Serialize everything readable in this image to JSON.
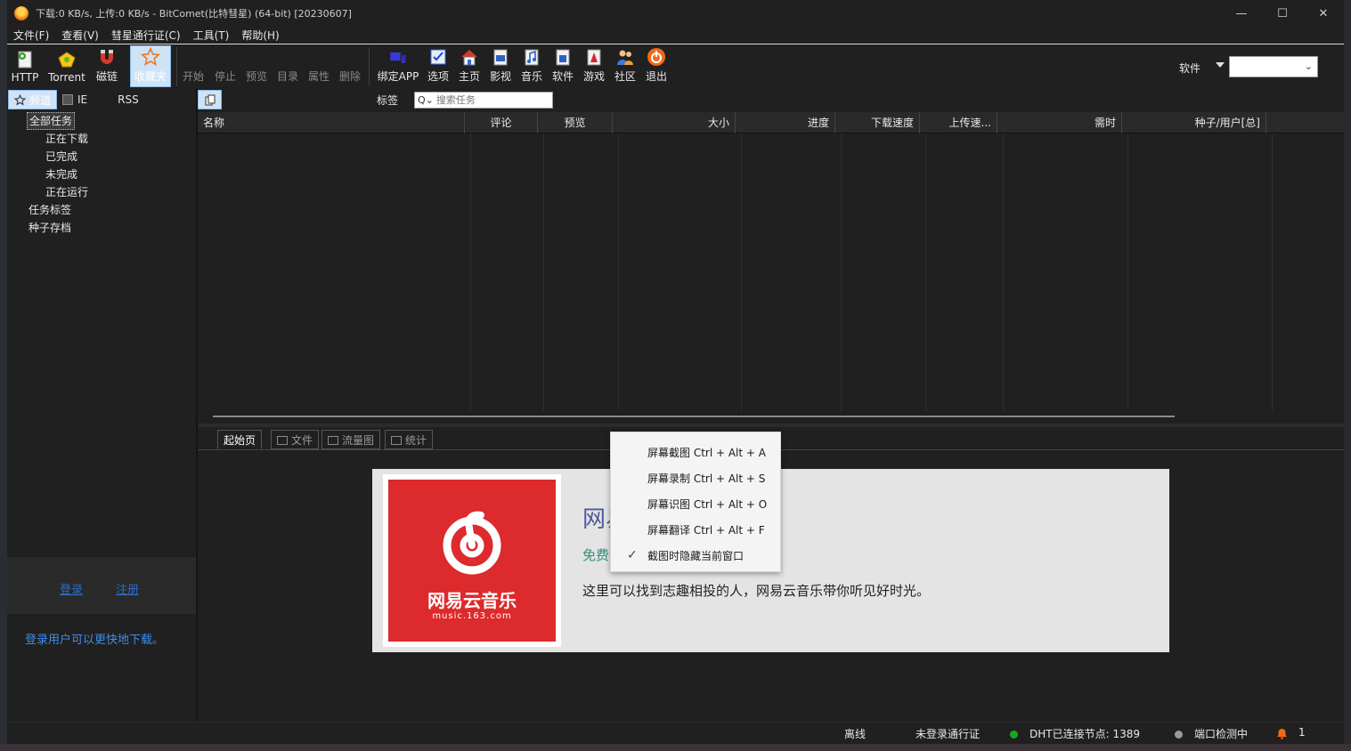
{
  "window": {
    "title": "下载:0 KB/s, 上传:0 KB/s - BitComet(比特彗星) (64-bit) [20230607]",
    "minimize": "—",
    "maximize": "☐",
    "close": "✕"
  },
  "menu": [
    "文件(F)",
    "查看(V)",
    "彗星通行证(C)",
    "工具(T)",
    "帮助(H)"
  ],
  "toolbar": {
    "http": "HTTP",
    "torrent": "Torrent",
    "magnet": "磁链",
    "favorites": "收藏夹",
    "start": "开始",
    "stop": "停止",
    "preview": "预览",
    "dir": "目录",
    "props": "属性",
    "delete": "删除",
    "bind_app": "绑定APP",
    "options": "选项",
    "home": "主页",
    "video": "影视",
    "music": "音乐",
    "software": "软件",
    "games": "游戏",
    "community": "社区",
    "exit": "退出"
  },
  "software_filter": {
    "label": "软件",
    "value": ""
  },
  "left_tabs": {
    "channel": "频道",
    "ie": "IE",
    "rss": "RSS"
  },
  "tree": {
    "all": "全部任务",
    "downloading": "正在下载",
    "completed": "已完成",
    "incomplete": "未完成",
    "running": "正在运行",
    "tags": "任务标签",
    "archive": "种子存档"
  },
  "task_row": {
    "tag_label": "标签",
    "search_placeholder": "搜索任务"
  },
  "columns": [
    "名称",
    "评论",
    "预览",
    "大小",
    "进度",
    "下载速度",
    "上传速...",
    "需时",
    "种子/用户[总]"
  ],
  "login": {
    "login": "登录",
    "register": "注册",
    "tip": "登录用户可以更快地下载。"
  },
  "bottom_tabs": {
    "start": "起始页",
    "files": "文件",
    "flow": "流量图",
    "stats": "统计"
  },
  "ad": {
    "logo_name": "网易云音乐",
    "logo_url": "music.163.com",
    "title": "网易云音乐",
    "subtitle": "免费",
    "desc": "这里可以找到志趣相投的人，网易云音乐带你听见好时光。"
  },
  "context_menu": [
    "屏幕截图 Ctrl + Alt + A",
    "屏幕录制 Ctrl + Alt + S",
    "屏幕识图 Ctrl + Alt + O",
    "屏幕翻译 Ctrl + Alt + F",
    "截图时隐藏当前窗口"
  ],
  "status": {
    "offline": "离线",
    "not_logged": "未登录通行证",
    "dht": "DHT已连接节点:  1389",
    "port": "端口检测中",
    "alerts": "1",
    "dht_color": "#19a61f",
    "port_color": "#9a9a9a"
  }
}
